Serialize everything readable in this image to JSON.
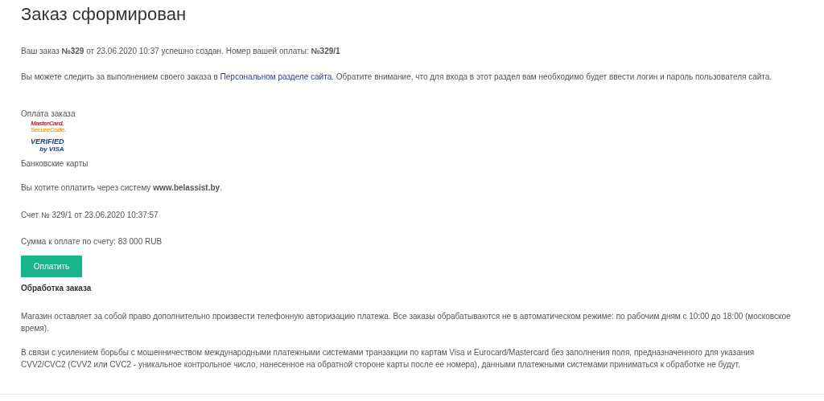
{
  "title": "Заказ сформирован",
  "order_message": "Ваш заказ **№329** от 23.06.2020 10:37 успешно создан. Номер вашей оплаты: **№329/1**",
  "tracking": {
    "before": "Вы можете следить за выполнением своего заказа в",
    "link": "Персональном разделе сайта",
    "after": ". Обратите внимание, что для входа в этот раздел вам необходимо будет ввести логин и пароль пользователя сайта."
  },
  "payment": {
    "heading": "Оплата заказа",
    "logos": [
      {
        "kind": "mastercard",
        "lines": [
          "MasterCard.",
          "SecureCode."
        ]
      },
      {
        "kind": "visa",
        "lines": [
          "VERIFIED",
          "by VISA"
        ]
      }
    ],
    "method": "Банковские карты",
    "system_note": "Вы хотите оплатить через систему **www.belassist.by**.",
    "invoice": "Счет № 329/1 от 23.06.2020 10:37:57",
    "amount": "Сумма к оплате по счету: 83 000 RUB",
    "pay_button": "Оплатить"
  },
  "processing": {
    "heading": "Обработка заказа",
    "paragraphs": [
      "Магазин оставляет за собой право дополнительно произвести телефонную авторизацию платежа. Все заказы обрабатываются не в автоматическом режиме: по рабочим дням с 10:00 до 18:00 (московское время).",
      "В связи с усилением борьбы с мошенничеством международными платежными системами транзакции по картам Visa и Eurocard/Mastercard без заполнения поля, предназначенного для указания CVV2/CVC2 (CVV2 или CVC2 - уникальное контрольное число, нанесенное на обратной стороне карты после ее номера), данными платежными системами приниматься к обработке не будут."
    ]
  }
}
